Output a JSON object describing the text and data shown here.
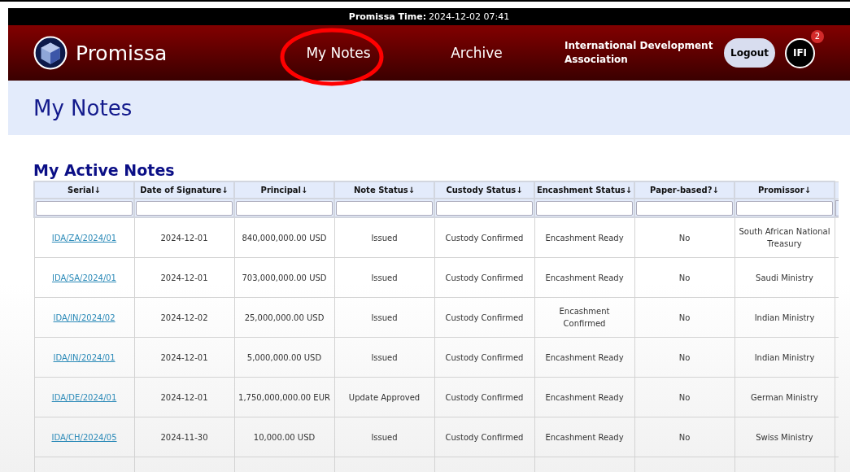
{
  "time_bar": {
    "label": "Promissa Time:",
    "value": "2024-12-02 07:41"
  },
  "header": {
    "logo_text": "Promissa",
    "nav": [
      {
        "label": "My Notes",
        "circled": true
      },
      {
        "label": "Archive",
        "circled": false
      }
    ],
    "organization": "International Development Association",
    "logout": "Logout",
    "avatar": {
      "initials": "IFI",
      "badge": "2"
    }
  },
  "page_title": "My Notes",
  "section_title": "My Active Notes",
  "table": {
    "columns": [
      "Serial↓",
      "Date of Signature↓",
      "Principal↓",
      "Note Status↓",
      "Custody Status↓",
      "Encashment Status↓",
      "Paper-based?↓",
      "Promissor↓"
    ],
    "rows": [
      {
        "cells": [
          "IDA/ZA/2024/01",
          "2024-12-01",
          "840,000,000.00 USD",
          "Issued",
          "Custody Confirmed",
          "Encashment Ready",
          "No",
          "South African National Treasury"
        ]
      },
      {
        "cells": [
          "IDA/SA/2024/01",
          "2024-12-01",
          "703,000,000.00 USD",
          "Issued",
          "Custody Confirmed",
          "Encashment Ready",
          "No",
          "Saudi Ministry"
        ]
      },
      {
        "cells": [
          "IDA/IN/2024/02",
          "2024-12-02",
          "25,000,000.00 USD",
          "Issued",
          "Custody Confirmed",
          "Encashment Confirmed",
          "No",
          "Indian Ministry"
        ]
      },
      {
        "cells": [
          "IDA/IN/2024/01",
          "2024-12-01",
          "5,000,000.00 USD",
          "Issued",
          "Custody Confirmed",
          "Encashment Ready",
          "No",
          "Indian Ministry"
        ]
      },
      {
        "cells": [
          "IDA/DE/2024/01",
          "2024-12-01",
          "1,750,000,000.00 EUR",
          "Update Approved",
          "Custody Confirmed",
          "Encashment Ready",
          "No",
          "German Ministry"
        ]
      },
      {
        "cells": [
          "IDA/CH/2024/05",
          "2024-11-30",
          "10,000.00 USD",
          "Issued",
          "Custody Confirmed",
          "Encashment Ready",
          "No",
          "Swiss Ministry"
        ]
      }
    ]
  }
}
